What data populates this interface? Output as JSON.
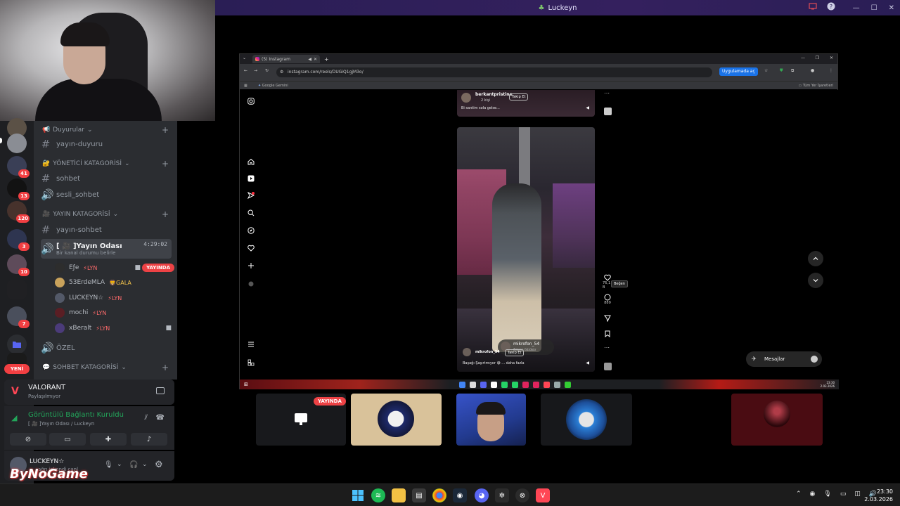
{
  "window": {
    "title": "Luckeyn"
  },
  "rail": {
    "badges": [
      "41",
      "13",
      "120",
      "3",
      "10",
      "7"
    ],
    "new_label": "YENİ"
  },
  "channels": {
    "cat_duyurular": "Duyurular",
    "ch_yayin_duyuru": "yayın-duyuru",
    "cat_yonetici": "YÖNETİCİ KATAGORİSİ",
    "ch_sohbet": "sohbet",
    "ch_sesli_sohbet": "sesli_sohbet",
    "cat_yayin": "YAYIN KATAGORİSİ",
    "ch_yayin_sohbet": "yayın-sohbet",
    "voice_channel": "[ 🎥 ]Yayın Odası",
    "voice_status": "Bir kanal durumu belirle",
    "voice_timer": "4:29:02",
    "voice_users": [
      {
        "name": "Eƒe",
        "tag": "LYN",
        "live": true
      },
      {
        "name": "53ErdeMLA",
        "tag": "GALA",
        "live": false
      },
      {
        "name": "LUCKEYN☆",
        "tag": "LYN",
        "live": false
      },
      {
        "name": "mochi",
        "tag": "LYN",
        "live": false
      },
      {
        "name": "xBeralt",
        "tag": "LYN",
        "live": false
      }
    ],
    "live_label": "YAYINDA",
    "ch_ozel": "ÖZEL",
    "cat_sohbet": "SOHBET KATAGORİSİ"
  },
  "activity": {
    "game": "VALORANT",
    "status": "Paylaşılmıyor"
  },
  "rtc": {
    "title": "Görüntülü Bağlantı Kuruldu",
    "subtitle": "[ 🎥 ]Yayın Odası / Luckeyn"
  },
  "user": {
    "name": "LUCKEYN☆",
    "status": "ağrı işkendi canl"
  },
  "overlay": {
    "brand": "ByNoGame"
  },
  "browser": {
    "tab_title": "(5) Instagram",
    "url": "instagram.com/reels/DUGiQ1gjM3o/",
    "open_app": "Uygulamada aç",
    "bookmark": "Google Gemini",
    "all_bookmarks": "Tüm Yer İşaretleri"
  },
  "instagram": {
    "top_user": "berkantpristine",
    "top_follow": "Takip Et",
    "top_followers": "2 kişi",
    "top_caption": "Bi santim sola gelse...",
    "reel_user": "mikrofon_54",
    "reel_follow": "Takip Et",
    "reel_caption": "Başağı Şaşırtmıyor 😅 ... daha fazla",
    "tooltip_like": "Beğen",
    "like_count": "76,1 B",
    "comment_count": "889",
    "overlay_user": "mikrofon_54",
    "overlay_sub": "Ödeme Gözükür",
    "messages": "Mesajlar"
  },
  "inner_clock": {
    "time": "23:30",
    "date": "2.03.2026"
  },
  "stream_tiles": {
    "live_label": "YAYINDA"
  },
  "taskbar": {
    "time": "23:30",
    "date": "2.03.2026"
  },
  "colors": {
    "discord_bg": "#2b2d31",
    "accent_red": "#ed4245",
    "green": "#23a55a",
    "title_purple": "#34205e"
  }
}
